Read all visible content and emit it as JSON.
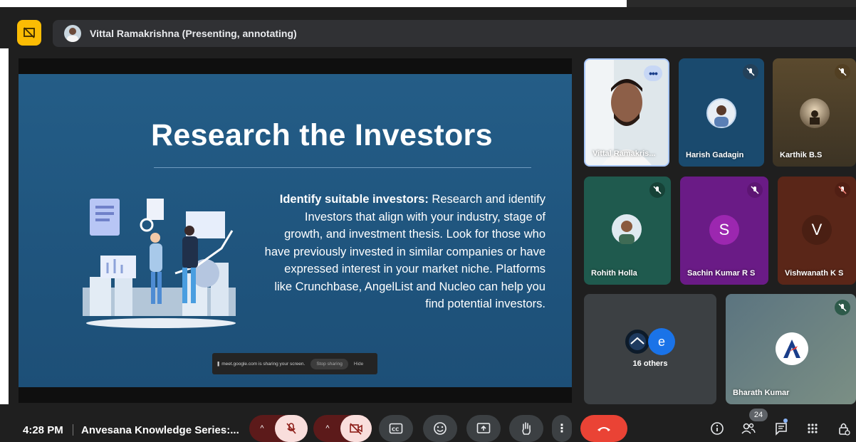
{
  "presenting": {
    "label": "Vittal Ramakrishna (Presenting, annotating)"
  },
  "slide": {
    "title": "Research the Investors",
    "body_bold": "Identify suitable investors:",
    "body_text": " Research and identify Investors that align with your industry, stage of growth, and investment thesis. Look for those who have previously invested in similar companies or have expressed interest in your market niche. Platforms like Crunchbase, AngelList and Nucleo can help you find potential investors.",
    "share_notice": "meet.google.com is sharing your screen.",
    "stop_sharing": "Stop sharing",
    "hide": "Hide"
  },
  "participants": [
    {
      "name": "Vittal Ramakris...",
      "type": "video"
    },
    {
      "name": "Harish Gadagin",
      "type": "photo"
    },
    {
      "name": "Karthik B.S",
      "type": "photo"
    },
    {
      "name": "Rohith Holla",
      "type": "photo"
    },
    {
      "name": "Sachin Kumar R S",
      "initial": "S",
      "type": "initial",
      "color": "#7b1fa2"
    },
    {
      "name": "Vishwanath K S",
      "initial": "V",
      "type": "initial",
      "color": "#6d2e1f"
    },
    {
      "name": "16 others",
      "type": "group",
      "initial": "e"
    },
    {
      "name": "Bharath Kumar",
      "type": "logo"
    }
  ],
  "bottom": {
    "time": "4:28 PM",
    "meeting_title": "Anvesana Knowledge Series:...",
    "participant_count": "24"
  },
  "colors": {
    "accent_yellow": "#fbbc04",
    "end_call_red": "#ea4335",
    "slide_blue": "#245d87"
  }
}
